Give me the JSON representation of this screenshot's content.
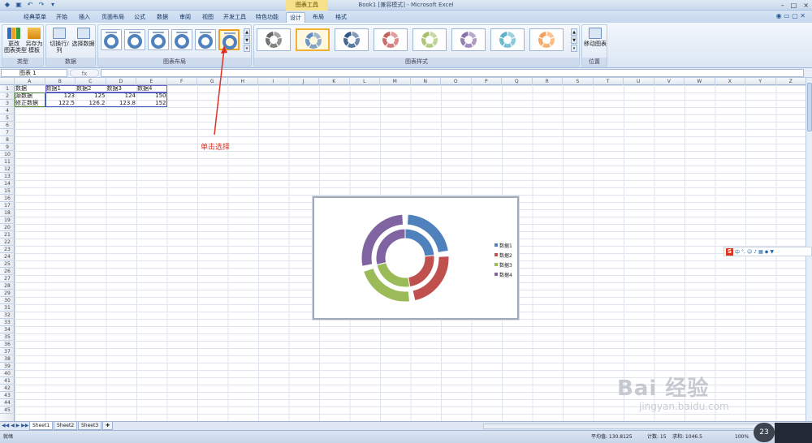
{
  "title_bar": {
    "window_title": "Book1 [兼容模式] - Microsoft Excel",
    "context_tools_label": "图表工具",
    "window_controls": [
      "–",
      "□",
      "×"
    ]
  },
  "tabs": [
    {
      "label": "经典菜单",
      "active": false
    },
    {
      "label": "开始",
      "active": false
    },
    {
      "label": "插入",
      "active": false
    },
    {
      "label": "页面布局",
      "active": false
    },
    {
      "label": "公式",
      "active": false
    },
    {
      "label": "数据",
      "active": false
    },
    {
      "label": "审阅",
      "active": false
    },
    {
      "label": "视图",
      "active": false
    },
    {
      "label": "开发工具",
      "active": false
    },
    {
      "label": "特色功能",
      "active": false
    },
    {
      "label": "设计",
      "active": true
    },
    {
      "label": "布局",
      "active": false
    },
    {
      "label": "格式",
      "active": false
    }
  ],
  "ribbon": {
    "groups": {
      "type": {
        "label": "类型",
        "buttons": [
          "更改\n图表类型",
          "另存为\n模板"
        ]
      },
      "data": {
        "label": "数据",
        "buttons": [
          "切换行/列",
          "选择数据"
        ]
      },
      "layout": {
        "label": "图表布局",
        "layout_count": 6,
        "selected_index": 5
      },
      "styles": {
        "label": "图表样式",
        "style_colors": [
          "#555555",
          "#4f81bd",
          "#1f497d",
          "#c0504d",
          "#9bbb59",
          "#8064a2",
          "#4bacc6",
          "#f79646"
        ],
        "selected_index": 1
      },
      "location": {
        "label": "位置",
        "buttons": [
          "移动图表"
        ]
      }
    }
  },
  "formula_bar": {
    "name_box": "图表 1",
    "fx_label": "fx",
    "formula": ""
  },
  "columns": [
    "A",
    "B",
    "C",
    "D",
    "E",
    "F",
    "G",
    "H",
    "I",
    "J",
    "K",
    "L",
    "M",
    "N",
    "O",
    "P",
    "Q",
    "R",
    "S",
    "T",
    "U",
    "V",
    "W",
    "X",
    "Y",
    "Z"
  ],
  "row_count": 45,
  "cells": {
    "A1": "数据",
    "B1": "数据1",
    "C1": "数据2",
    "D1": "数据3",
    "E1": "数据4",
    "A2": "源数据",
    "B2": "123",
    "C2": "125",
    "D2": "124",
    "E2": "150",
    "A3": "修正数据",
    "B3": "122.5",
    "C3": "126.2",
    "D3": "123.8",
    "E3": "152"
  },
  "chart_data": {
    "type": "doughnut",
    "categories": [
      "数据1",
      "数据2",
      "数据3",
      "数据4"
    ],
    "series": [
      {
        "name": "源数据",
        "values": [
          123,
          125,
          124,
          150
        ]
      },
      {
        "name": "修正数据",
        "values": [
          122.5,
          126.2,
          123.8,
          152
        ]
      }
    ],
    "colors": [
      "#4f81bd",
      "#c0504d",
      "#9bbb59",
      "#8064a2"
    ],
    "legend_position": "right",
    "title": ""
  },
  "annotation": {
    "text": "单击选择",
    "color": "#e03020"
  },
  "sheet_tabs": [
    "Sheet1",
    "Sheet2",
    "Sheet3"
  ],
  "status_bar": {
    "ready": "就绪",
    "average": "平均值: 130.8125",
    "count": "计数: 15",
    "sum": "求和: 1046.5",
    "zoom": "100%"
  },
  "ime_toolbar": {
    "logo": "S",
    "mode": "中"
  },
  "watermark": {
    "brand": "Bai 经验",
    "url": "jingyan.baidu.com"
  },
  "clock_badge": "23"
}
